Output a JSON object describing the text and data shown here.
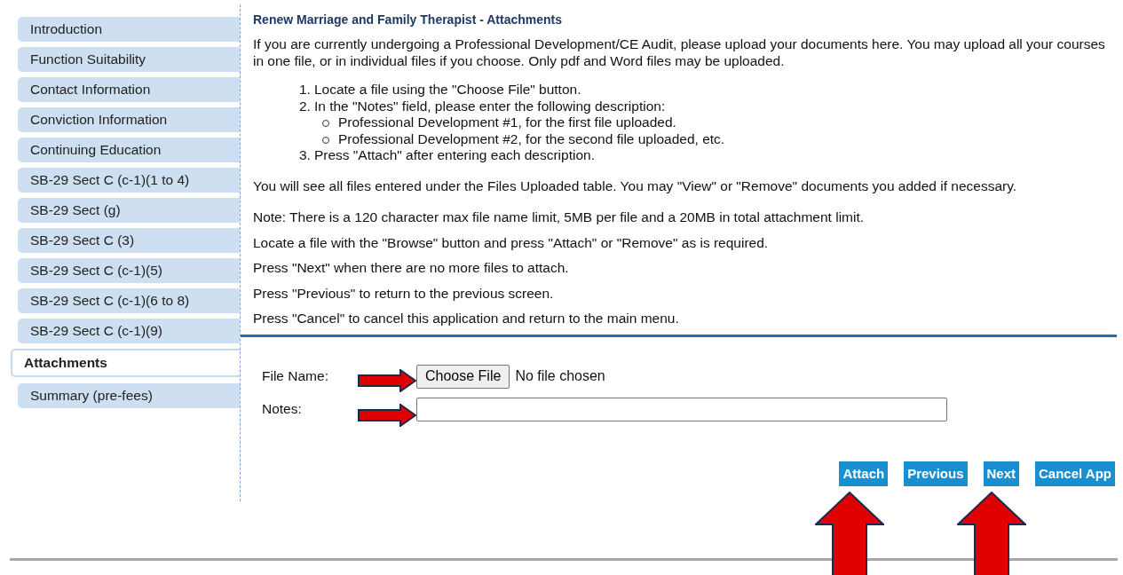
{
  "sidebar": {
    "items": [
      {
        "label": "Introduction",
        "selected": false
      },
      {
        "label": "Function Suitability",
        "selected": false
      },
      {
        "label": "Contact Information",
        "selected": false
      },
      {
        "label": "Conviction Information",
        "selected": false
      },
      {
        "label": "Continuing Education",
        "selected": false
      },
      {
        "label": "SB-29 Sect C (c-1)(1 to 4)",
        "selected": false
      },
      {
        "label": "SB-29 Sect (g)",
        "selected": false
      },
      {
        "label": "SB-29 Sect C (3)",
        "selected": false
      },
      {
        "label": "SB-29 Sect C (c-1)(5)",
        "selected": false
      },
      {
        "label": "SB-29 Sect C (c-1)(6 to 8)",
        "selected": false
      },
      {
        "label": "SB-29 Sect C (c-1)(9)",
        "selected": false
      },
      {
        "label": "Attachments",
        "selected": true
      },
      {
        "label": "Summary (pre-fees)",
        "selected": false
      }
    ]
  },
  "main": {
    "title": "Renew Marriage and Family Therapist - Attachments",
    "intro": "If you are currently undergoing a Professional Development/CE Audit, please upload your documents here. You may upload all your courses in one file, or in individual files if you choose. Only pdf and Word files may be uploaded.",
    "steps": [
      {
        "number": "1.",
        "text": "Locate a file using the \"Choose File\" button."
      },
      {
        "number": "2.",
        "text": "In the \"Notes\" field, please enter the following description:",
        "children": [
          {
            "text": "Professional Development #1, for the first file uploaded."
          },
          {
            "text": "Professional Development #2, for the second file uploaded, etc."
          }
        ]
      },
      {
        "number": "3.",
        "text": "Press \"Attach\" after entering each description."
      }
    ],
    "files_note": "You will see all files entered under the Files Uploaded table. You may \"View\" or \"Remove\" documents you added if necessary.",
    "instructions": [
      "Note: There is a 120 character max file name limit, 5MB per file and a 20MB in total attachment limit.",
      "Locate a file with the \"Browse\" button and press \"Attach\" or \"Remove\" as is required.",
      "Press \"Next\" when there are no more files to attach.",
      "Press \"Previous\" to return to the previous screen.",
      "Press \"Cancel\" to cancel this application and return to the main menu."
    ]
  },
  "form": {
    "file_label": "File Name:",
    "choose_button": "Choose File",
    "file_status": "No file chosen",
    "notes_label": "Notes:"
  },
  "buttons": [
    "Attach",
    "Previous",
    "Next",
    "Cancel App"
  ]
}
